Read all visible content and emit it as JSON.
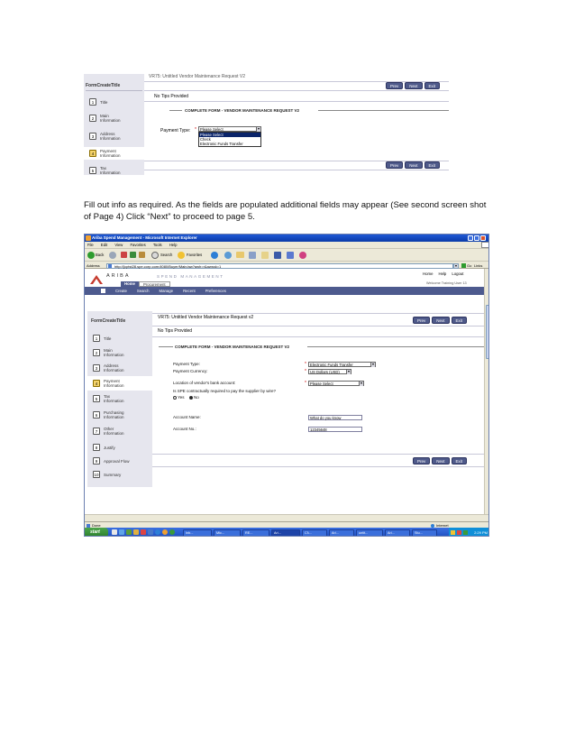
{
  "top_screenshot": {
    "header_text": "VR75: Untitled Vendor Maintenance Request V2",
    "sidebar_title": "FormCreateTitle",
    "steps": [
      {
        "num": "1",
        "label": "Title"
      },
      {
        "num": "2",
        "label": "Main Information"
      },
      {
        "num": "3",
        "label": "Address Information"
      },
      {
        "num": "4",
        "label": "Payment Information"
      },
      {
        "num": "5",
        "label": "Tax Information"
      }
    ],
    "buttons": {
      "prev": "Prev",
      "next": "Next",
      "exit": "Exit"
    },
    "tips": "No Tips Provided",
    "section_title": "COMPLETE FORM - VENDOR MAINTENANCE REQUEST V2",
    "payment_type_label": "Payment Type:",
    "required_mark": "*",
    "dropdown_value": "Please Select",
    "dropdown_options": [
      "Please Select",
      "Check",
      "Electronic Funds Transfer"
    ]
  },
  "instruction": "Fill out info as required.  As the fields are populated additional fields may appear (See second screen shot of Page 4) Click “Next” to proceed to page 5.",
  "bottom_screenshot": {
    "window_title": "Ariba Spend Management - Microsoft Internet Explorer",
    "menu": [
      "File",
      "Edit",
      "View",
      "Favorites",
      "Tools",
      "Help"
    ],
    "toolbar": {
      "back": "Back",
      "search": "Search",
      "favorites": "Favorites"
    },
    "address_label": "Address",
    "address_value": "http://[cptst28.spe.corp.com:8080/Buyer/Main/aw?awh=r&awssk=1",
    "go": "Go",
    "links": "Links",
    "brand": "ARIBA",
    "brand_sub": "SPEND MANAGEMENT",
    "top_links": [
      "Home",
      "Help",
      "Logout"
    ],
    "welcome": "Welcome Training User 13",
    "tabs": [
      "Home",
      "Procurement"
    ],
    "nav": [
      "Create",
      "Search",
      "Manage",
      "Recent",
      "Preferences"
    ],
    "header_text": "VR75: Untitled Vendor Maintenance Request v2",
    "sidebar_title": "FormCreateTitle",
    "steps": [
      {
        "num": "1",
        "label": "Title"
      },
      {
        "num": "2",
        "label": "Main Information"
      },
      {
        "num": "3",
        "label": "Address Information"
      },
      {
        "num": "4",
        "label": "Payment Information"
      },
      {
        "num": "5",
        "label": "Tax Information"
      },
      {
        "num": "6",
        "label": "Purchasing Information"
      },
      {
        "num": "7",
        "label": "Other Information"
      },
      {
        "num": "8",
        "label": "Justify"
      },
      {
        "num": "9",
        "label": "Approval Flow"
      },
      {
        "num": "10",
        "label": "Summary"
      }
    ],
    "buttons": {
      "prev": "Prev",
      "next": "Next",
      "exit": "Exit"
    },
    "tips": "No Tips Provided",
    "section_title": "COMPLETE FORM - VENDOR MAINTENANCE REQUEST V2",
    "fields": {
      "payment_type": {
        "label": "Payment Type:",
        "value": "Electronic Funds Transfer"
      },
      "payment_currency": {
        "label": "Payment Currency:",
        "value": "US Dollars (USD)"
      },
      "bank_location": {
        "label": "Location of vendor's bank account:",
        "value": "Please Select"
      },
      "wire_question": "Is SPE contractually required to pay the supplier by wire?",
      "wire_yes": "Yes",
      "wire_no": "No",
      "account_name": {
        "label": "Account Name:",
        "value": "What do you know"
      },
      "account_no": {
        "label": "Account No.:",
        "value": "12345648"
      }
    },
    "required_mark": "*",
    "status_left": "Done",
    "status_right": "Internet",
    "start": "start",
    "tasks": [
      "Inb...",
      "Mic...",
      "RE...",
      "Ari...",
      "Cl\\...",
      "Ari...",
      "untit...",
      "Ari...",
      "Stu..."
    ],
    "clock": "2:29 PM"
  }
}
